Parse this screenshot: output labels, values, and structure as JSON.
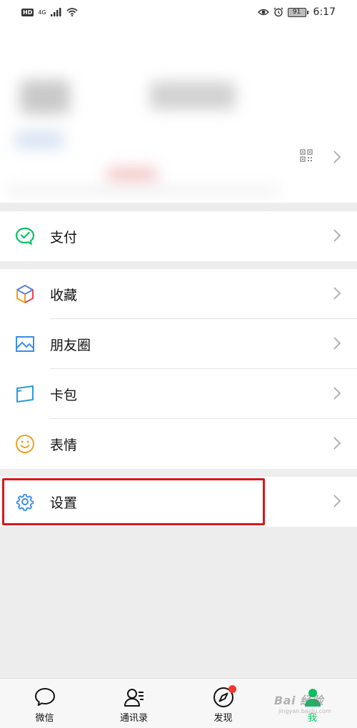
{
  "status_bar": {
    "hd": "HD",
    "network": "4G",
    "battery": "91",
    "time": "6:17"
  },
  "menu": {
    "pay": "支付",
    "favorites": "收藏",
    "moments": "朋友圈",
    "cards": "卡包",
    "stickers": "表情",
    "settings": "设置"
  },
  "tabs": {
    "chats": "微信",
    "contacts": "通讯录",
    "discover": "发现",
    "me": "我"
  },
  "colors": {
    "accent_green": "#07c160",
    "highlight_red": "#d9161b",
    "badge_red": "#f43530"
  },
  "watermark": {
    "text": "Bai 经验",
    "sub": "jingyan.baidu.com"
  }
}
